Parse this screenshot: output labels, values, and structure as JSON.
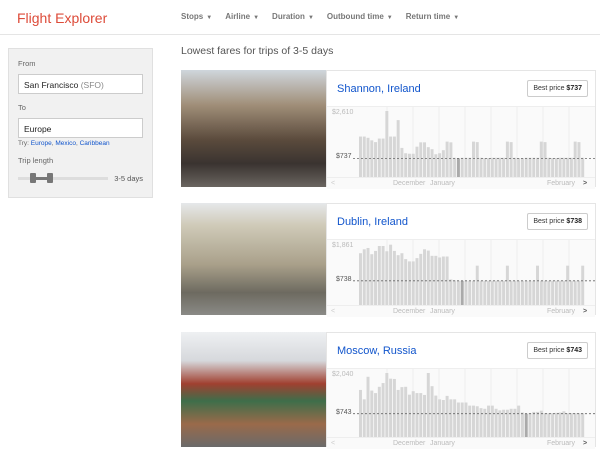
{
  "app": {
    "title": "Flight Explorer"
  },
  "filters": [
    {
      "label": "Stops"
    },
    {
      "label": "Airline"
    },
    {
      "label": "Duration"
    },
    {
      "label": "Outbound time"
    },
    {
      "label": "Return time"
    }
  ],
  "sidebar": {
    "from_label": "From",
    "from_value": "San Francisco",
    "from_code": "(SFO)",
    "to_label": "To",
    "to_value": "Europe",
    "try_label": "Try:",
    "try_links": [
      "Europe",
      "Mexico",
      "Caribbean"
    ],
    "trip_label": "Trip length",
    "trip_value": "3-5 days",
    "trip_range": [
      3,
      5
    ]
  },
  "results_heading": "Lowest fares for trips of 3-5 days",
  "axis": {
    "m1": "December",
    "m2": "January",
    "m3": "February"
  },
  "results": [
    {
      "destination": "Shannon, Ireland",
      "best_label": "Best price",
      "best_price": "$737",
      "max_label": "$2,610",
      "min_label": "$737",
      "max": 2610,
      "min": 737,
      "min_index": 26,
      "prices": [
        1600,
        1600,
        1550,
        1450,
        1380,
        1520,
        1520,
        2610,
        1600,
        1600,
        2250,
        1150,
        940,
        920,
        920,
        1200,
        1370,
        1370,
        1180,
        1100,
        900,
        940,
        1060,
        1400,
        1370,
        760,
        737,
        760,
        760,
        760,
        1400,
        1380,
        760,
        750,
        750,
        760,
        760,
        760,
        760,
        1400,
        1380,
        760,
        750,
        750,
        760,
        760,
        760,
        760,
        1400,
        1380,
        760,
        750,
        750,
        760,
        760,
        760,
        760,
        1400,
        1380,
        760
      ]
    },
    {
      "destination": "Dublin, Ireland",
      "best_label": "Best price",
      "best_price": "$738",
      "max_label": "$1,861",
      "min_label": "$738",
      "max": 1861,
      "min": 738,
      "min_index": 27,
      "prices": [
        1580,
        1700,
        1740,
        1550,
        1650,
        1800,
        1800,
        1640,
        1840,
        1650,
        1520,
        1580,
        1400,
        1330,
        1330,
        1430,
        1560,
        1700,
        1660,
        1500,
        1500,
        1450,
        1480,
        1480,
        780,
        750,
        740,
        738,
        740,
        740,
        740,
        1200,
        740,
        740,
        740,
        740,
        740,
        740,
        740,
        1200,
        740,
        740,
        740,
        740,
        740,
        740,
        740,
        1200,
        740,
        740,
        740,
        740,
        740,
        740,
        740,
        1200,
        740,
        740,
        740,
        1200
      ]
    },
    {
      "destination": "Moscow, Russia",
      "best_label": "Best price",
      "best_price": "$743",
      "max_label": "$2,040",
      "min_label": "$743",
      "max": 2040,
      "min": 743,
      "min_index": 44,
      "prices": [
        1500,
        1200,
        1920,
        1480,
        1400,
        1600,
        1720,
        2040,
        1860,
        1850,
        1500,
        1590,
        1600,
        1350,
        1460,
        1400,
        1400,
        1340,
        2040,
        1620,
        1320,
        1200,
        1180,
        1310,
        1200,
        1200,
        1100,
        1100,
        1100,
        1000,
        1000,
        980,
        920,
        900,
        1000,
        1000,
        900,
        850,
        870,
        870,
        900,
        900,
        1000,
        780,
        743,
        760,
        800,
        800,
        840,
        760,
        760,
        760,
        770,
        780,
        820,
        760,
        760,
        760,
        760,
        760
      ]
    }
  ]
}
